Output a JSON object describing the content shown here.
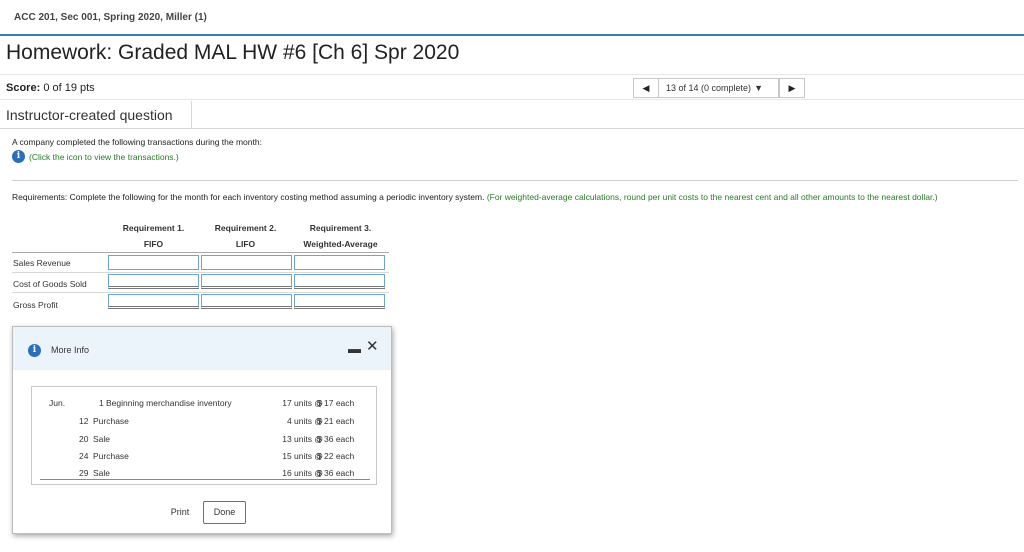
{
  "header": {
    "course": "ACC 201, Sec 001, Spring 2020, Miller (1)",
    "homework_title": "Homework: Graded MAL HW #6 [Ch 6] Spr 2020"
  },
  "score": {
    "label": "Score:",
    "value": "0 of 19 pts"
  },
  "nav": {
    "status": "13 of 14 (0 complete)"
  },
  "question": {
    "type": "Instructor-created question",
    "intro": "A company completed the following transactions during the month:",
    "info_link": "(Click the icon to view the transactions.)",
    "requirements_label": "Requirements:",
    "requirements_text": " Complete the following for the month for each inventory costing method assuming a periodic inventory system. ",
    "requirements_note": "(For weighted-average calculations, round per unit costs to the nearest cent and all other amounts to the nearest dollar.)"
  },
  "table": {
    "columns": [
      {
        "req": "Requirement 1.",
        "method": "FIFO"
      },
      {
        "req": "Requirement 2.",
        "method": "LIFO"
      },
      {
        "req": "Requirement 3.",
        "method": "Weighted-Average"
      }
    ],
    "rows": [
      {
        "label": "Sales Revenue",
        "values": [
          "",
          "",
          ""
        ]
      },
      {
        "label": "Cost of Goods Sold",
        "values": [
          "",
          "",
          ""
        ]
      },
      {
        "label": "Gross Profit",
        "values": [
          "",
          "",
          ""
        ]
      }
    ]
  },
  "modal": {
    "title": "More Info",
    "month": "Jun.",
    "transactions": [
      {
        "day": "1",
        "desc": "Beginning merchandise inventory",
        "units": "17 units @",
        "dollar": "$",
        "cost": "17 each"
      },
      {
        "day": "12",
        "desc": "Purchase",
        "units": "4 units @",
        "dollar": "$",
        "cost": "21 each"
      },
      {
        "day": "20",
        "desc": "Sale",
        "units": "13 units @",
        "dollar": "$",
        "cost": "36 each"
      },
      {
        "day": "24",
        "desc": "Purchase",
        "units": "15 units @",
        "dollar": "$",
        "cost": "22 each"
      },
      {
        "day": "29",
        "desc": "Sale",
        "units": "16 units @",
        "dollar": "$",
        "cost": "36 each"
      }
    ],
    "print_label": "Print",
    "done_label": "Done"
  },
  "colors": {
    "accent": "#3a7cb8",
    "info_icon": "#2a6fb8",
    "link_green": "#2a7a2a",
    "modal_header": "#ebf3fb",
    "input_border": "#6aa4d8"
  },
  "icons": {
    "prev": "triangle-left-icon",
    "next": "triangle-right-icon",
    "dropdown": "caret-down-icon",
    "info": "info-circle-icon",
    "minimize": "minimize-icon",
    "close": "close-icon"
  }
}
